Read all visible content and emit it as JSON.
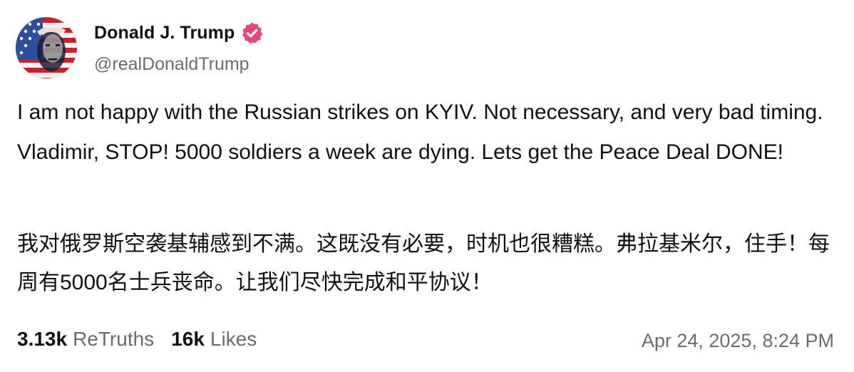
{
  "author": {
    "display_name": "Donald J. Trump",
    "handle": "@realDonaldTrump",
    "verified": true,
    "avatar_icon": "avatar-flag-portrait",
    "verified_color": "#e8457c"
  },
  "post": {
    "text_en": "I am not happy with the Russian strikes on KYIV. Not necessary, and very bad timing. Vladimir, STOP! 5000 soldiers a week are dying. Lets get the Peace Deal DONE!",
    "text_zh": "我对俄罗斯空袭基辅感到不满。这既没有必要，时机也很糟糕。弗拉基米尔，住手！每周有5000名士兵丧命。让我们尽快完成和平协议！"
  },
  "stats": {
    "retruths_count": "3.13k",
    "retruths_label": "ReTruths",
    "likes_count": "16k",
    "likes_label": "Likes"
  },
  "timestamp": "Apr 24, 2025, 8:24 PM"
}
